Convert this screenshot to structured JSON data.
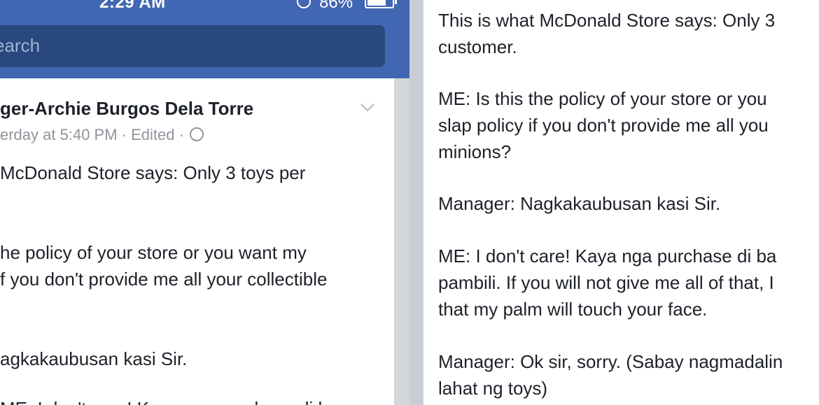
{
  "status_bar": {
    "time": "2:29 AM",
    "battery": "86%"
  },
  "search": {
    "placeholder": "earch"
  },
  "post": {
    "author": "ger-Archie Burgos Dela Torre",
    "meta": "erday at 5:40 PM · Edited ·",
    "left_lines": [
      "McDonald Store says: Only 3 toys per",
      "he policy of your store or you want my",
      "f you don't provide me all your collectible",
      "agkakaubusan kasi Sir.",
      "ME: I don't care! Kaya nga purchase di ba"
    ]
  },
  "zoom_panel": {
    "lines": [
      "This is what McDonald Store says: Only 3",
      "customer.",
      "ME: Is this the policy of your store or you",
      "slap policy if you don't provide me all you",
      "minions?",
      "Manager: Nagkakaubusan kasi Sir.",
      "ME: I don't care! Kaya nga purchase di ba",
      "pambili. If you will not give me all of that, I",
      "that my palm will touch your face.",
      "Manager: Ok sir, sorry. (Sabay nagmadalin",
      "lahat ng toys)"
    ]
  },
  "colors": {
    "facebook_blue": "#4267b2",
    "search_bg": "#29487d",
    "meta_gray": "#90949c"
  },
  "icons": [
    "lock-rotation-icon",
    "battery-icon",
    "chevron-down-icon",
    "globe-icon"
  ]
}
